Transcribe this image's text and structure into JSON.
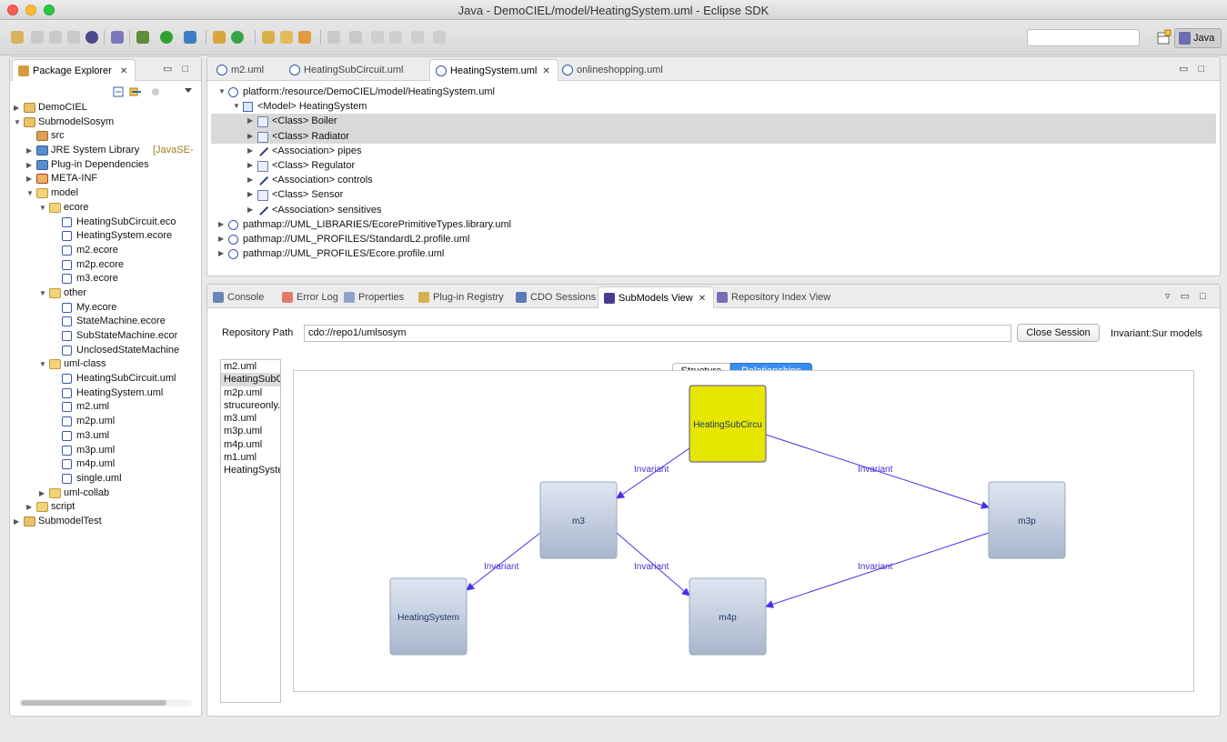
{
  "window": {
    "title": "Java - DemoCIEL/model/HeatingSystem.uml - Eclipse SDK"
  },
  "toolbar": {
    "perspective_label": "Java"
  },
  "package_explorer": {
    "tab_label": "Package Explorer",
    "tree": [
      {
        "label": "DemoCIEL",
        "depth": 0,
        "icon": "project-icon",
        "arrow": "right"
      },
      {
        "label": "SubmodelSosym",
        "depth": 0,
        "icon": "project-icon",
        "arrow": "down"
      },
      {
        "label": "src",
        "depth": 1,
        "icon": "source-folder-icon",
        "arrow": ""
      },
      {
        "label": "JRE System Library",
        "suffix": "[JavaSE-",
        "depth": 1,
        "icon": "library-icon",
        "arrow": "right"
      },
      {
        "label": "Plug-in Dependencies",
        "depth": 1,
        "icon": "library-icon",
        "arrow": "right"
      },
      {
        "label": "META-INF",
        "depth": 1,
        "icon": "meta-folder-icon",
        "arrow": "right"
      },
      {
        "label": "model",
        "depth": 1,
        "icon": "folder-icon",
        "arrow": "down"
      },
      {
        "label": "ecore",
        "depth": 2,
        "icon": "folder-icon",
        "arrow": "down"
      },
      {
        "label": "HeatingSubCircuit.eco",
        "depth": 3,
        "icon": "model-file-icon",
        "arrow": ""
      },
      {
        "label": "HeatingSystem.ecore",
        "depth": 3,
        "icon": "model-file-icon",
        "arrow": ""
      },
      {
        "label": "m2.ecore",
        "depth": 3,
        "icon": "model-file-icon",
        "arrow": ""
      },
      {
        "label": "m2p.ecore",
        "depth": 3,
        "icon": "model-file-icon",
        "arrow": ""
      },
      {
        "label": "m3.ecore",
        "depth": 3,
        "icon": "model-file-icon",
        "arrow": ""
      },
      {
        "label": "other",
        "depth": 2,
        "icon": "folder-icon",
        "arrow": "down"
      },
      {
        "label": "My.ecore",
        "depth": 3,
        "icon": "model-file-icon",
        "arrow": ""
      },
      {
        "label": "StateMachine.ecore",
        "depth": 3,
        "icon": "model-file-icon",
        "arrow": ""
      },
      {
        "label": "SubStateMachine.ecor",
        "depth": 3,
        "icon": "model-file-icon",
        "arrow": ""
      },
      {
        "label": "UnclosedStateMachine",
        "depth": 3,
        "icon": "model-file-icon",
        "arrow": ""
      },
      {
        "label": "uml-class",
        "depth": 2,
        "icon": "folder-icon",
        "arrow": "down"
      },
      {
        "label": "HeatingSubCircuit.uml",
        "depth": 3,
        "icon": "model-file-icon",
        "arrow": ""
      },
      {
        "label": "HeatingSystem.uml",
        "depth": 3,
        "icon": "model-file-icon",
        "arrow": ""
      },
      {
        "label": "m2.uml",
        "depth": 3,
        "icon": "model-file-icon",
        "arrow": ""
      },
      {
        "label": "m2p.uml",
        "depth": 3,
        "icon": "model-file-icon",
        "arrow": ""
      },
      {
        "label": "m3.uml",
        "depth": 3,
        "icon": "model-file-icon",
        "arrow": ""
      },
      {
        "label": "m3p.uml",
        "depth": 3,
        "icon": "model-file-icon",
        "arrow": ""
      },
      {
        "label": "m4p.uml",
        "depth": 3,
        "icon": "model-file-icon",
        "arrow": ""
      },
      {
        "label": "single.uml",
        "depth": 3,
        "icon": "model-file-icon",
        "arrow": ""
      },
      {
        "label": "uml-collab",
        "depth": 2,
        "icon": "folder-icon",
        "arrow": "right"
      },
      {
        "label": "script",
        "depth": 1,
        "icon": "folder-icon",
        "arrow": "right"
      },
      {
        "label": "SubmodelTest",
        "depth": 0,
        "icon": "project-icon",
        "arrow": "right"
      }
    ]
  },
  "editor": {
    "tabs": [
      {
        "label": "m2.uml",
        "active": false
      },
      {
        "label": "HeatingSubCircuit.uml",
        "active": false
      },
      {
        "label": "HeatingSystem.uml",
        "active": true
      },
      {
        "label": "onlineshopping.uml",
        "active": false
      }
    ],
    "tree": [
      {
        "label": "platform:/resource/DemoCIEL/model/HeatingSystem.uml",
        "depth": 0,
        "icon": "resource-icon",
        "arrow": "down",
        "selected": false
      },
      {
        "label": "<Model> HeatingSystem",
        "depth": 1,
        "icon": "model-icon",
        "arrow": "down",
        "selected": false
      },
      {
        "label": "<Class> Boiler",
        "depth": 2,
        "icon": "class-icon",
        "arrow": "right",
        "selected": true
      },
      {
        "label": "<Class> Radiator",
        "depth": 2,
        "icon": "class-icon",
        "arrow": "right",
        "selected": true
      },
      {
        "label": "<Association> pipes",
        "depth": 2,
        "icon": "association-icon",
        "arrow": "right",
        "selected": false
      },
      {
        "label": "<Class> Regulator",
        "depth": 2,
        "icon": "class-icon",
        "arrow": "right",
        "selected": false
      },
      {
        "label": "<Association> controls",
        "depth": 2,
        "icon": "association-icon",
        "arrow": "right",
        "selected": false
      },
      {
        "label": "<Class> Sensor",
        "depth": 2,
        "icon": "class-icon",
        "arrow": "right",
        "selected": false
      },
      {
        "label": "<Association> sensitives",
        "depth": 2,
        "icon": "association-icon",
        "arrow": "right",
        "selected": false
      },
      {
        "label": "pathmap://UML_LIBRARIES/EcorePrimitiveTypes.library.uml",
        "depth": 0,
        "icon": "resource-icon",
        "arrow": "right",
        "selected": false
      },
      {
        "label": "pathmap://UML_PROFILES/StandardL2.profile.uml",
        "depth": 0,
        "icon": "resource-icon",
        "arrow": "right",
        "selected": false
      },
      {
        "label": "pathmap://UML_PROFILES/Ecore.profile.uml",
        "depth": 0,
        "icon": "resource-icon",
        "arrow": "right",
        "selected": false
      }
    ]
  },
  "views": {
    "tabs": [
      {
        "label": "Console",
        "active": false
      },
      {
        "label": "Error Log",
        "active": false
      },
      {
        "label": "Properties",
        "active": false
      },
      {
        "label": "Plug-in Registry",
        "active": false
      },
      {
        "label": "CDO Sessions",
        "active": false
      },
      {
        "label": "SubModels View",
        "active": true
      },
      {
        "label": "Repository Index View",
        "active": false
      }
    ],
    "repository_path_label": "Repository Path",
    "repository_path_value": "cdo://repo1/umlsosym",
    "close_session_label": "Close Session",
    "invariant_label": "Invariant:Sur models",
    "model_list": [
      {
        "label": "m2.uml",
        "selected": false
      },
      {
        "label": "HeatingSubC",
        "selected": true
      },
      {
        "label": "m2p.uml",
        "selected": false
      },
      {
        "label": "strucureonly.",
        "selected": false
      },
      {
        "label": "m3.uml",
        "selected": false
      },
      {
        "label": "m3p.uml",
        "selected": false
      },
      {
        "label": "m4p.uml",
        "selected": false
      },
      {
        "label": "m1.uml",
        "selected": false
      },
      {
        "label": "HeatingSyste",
        "selected": false
      }
    ],
    "segmented": {
      "structure_label": "Structure",
      "relationships_label": "Relationships",
      "selected": "Relationships"
    },
    "graph": {
      "nodes": [
        {
          "id": "hsc",
          "label": "HeatingSubCircu",
          "style": "highlighted"
        },
        {
          "id": "m3",
          "label": "m3",
          "style": "normal"
        },
        {
          "id": "m3p",
          "label": "m3p",
          "style": "normal"
        },
        {
          "id": "hs",
          "label": "HeatingSystem",
          "style": "normal"
        },
        {
          "id": "m4p",
          "label": "m4p",
          "style": "normal"
        }
      ],
      "edges": [
        {
          "from": "hsc",
          "to": "m3",
          "label": "Invariant"
        },
        {
          "from": "hsc",
          "to": "m3p",
          "label": "Invariant"
        },
        {
          "from": "m3",
          "to": "hs",
          "label": "Invariant"
        },
        {
          "from": "m3",
          "to": "m4p",
          "label": "Invariant"
        },
        {
          "from": "m3p",
          "to": "m4p",
          "label": "Invariant"
        }
      ]
    }
  },
  "colors": {
    "highlight_node": "#e6e600",
    "normal_node_top": "#dfe6f2",
    "normal_node_bottom": "#a9b6cc",
    "edge": "#4b2ee8",
    "selection": "#d9d9d9"
  }
}
